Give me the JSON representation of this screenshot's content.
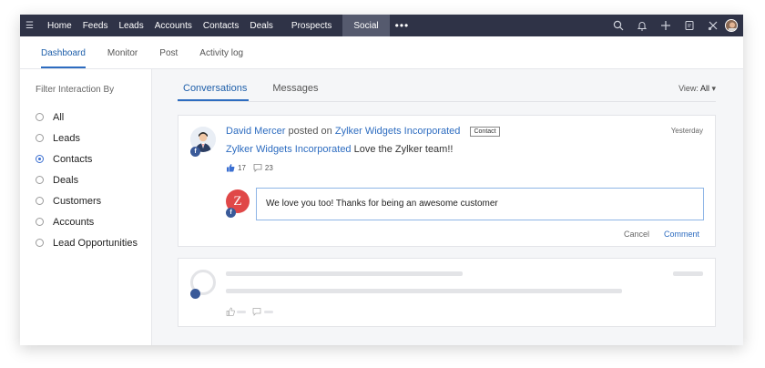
{
  "topnav": {
    "items": [
      {
        "label": "Home"
      },
      {
        "label": "Feeds"
      },
      {
        "label": "Leads"
      },
      {
        "label": "Accounts"
      },
      {
        "label": "Contacts"
      },
      {
        "label": "Deals"
      }
    ],
    "prospects": "Prospects",
    "active": "Social",
    "more": "•••",
    "icons": [
      "search-icon",
      "bell-icon",
      "plus-icon",
      "calendar-icon",
      "tools-icon",
      "user-avatar"
    ]
  },
  "subnav": {
    "tabs": [
      {
        "label": "Dashboard"
      },
      {
        "label": "Monitor"
      },
      {
        "label": "Post"
      },
      {
        "label": "Activity log"
      }
    ]
  },
  "sidebar": {
    "title": "Filter Interaction By",
    "options": [
      {
        "label": "All"
      },
      {
        "label": "Leads"
      },
      {
        "label": "Contacts"
      },
      {
        "label": "Deals"
      },
      {
        "label": "Customers"
      },
      {
        "label": "Accounts"
      },
      {
        "label": "Lead Opportunities"
      }
    ],
    "selected": "Contacts"
  },
  "main": {
    "tabs": [
      {
        "label": "Conversations"
      },
      {
        "label": "Messages"
      }
    ],
    "view_label": "View:",
    "view_value": "All"
  },
  "post": {
    "author": "David Mercer",
    "posted_on": "posted on",
    "page": "Zylker Widgets Incorporated",
    "tag": "Contact",
    "time": "Yesterday",
    "body_mention": "Zylker Widgets Incorporated",
    "body_text": "Love the Zylker team!!",
    "likes": "17",
    "comments": "23",
    "fb_badge": "f"
  },
  "reply": {
    "avatar_letter": "Z",
    "text": "We love you too! Thanks for being an awesome customer",
    "cancel": "Cancel",
    "comment": "Comment"
  },
  "colors": {
    "topnav_bg": "#2f3347",
    "accent": "#2d6cc0",
    "facebook": "#3a5a99",
    "reply_avatar": "#e04848"
  }
}
